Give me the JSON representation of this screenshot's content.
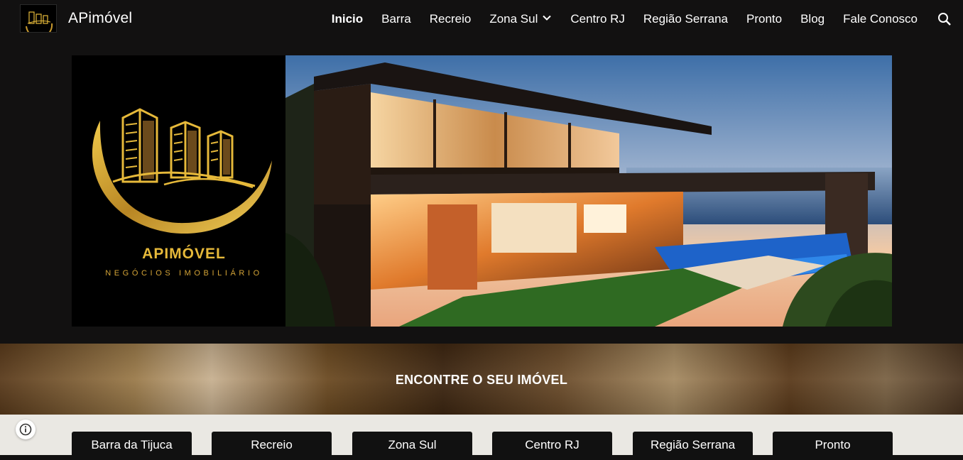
{
  "header": {
    "site_title": "APimóvel",
    "nav": [
      {
        "label": "Inicio",
        "active": true
      },
      {
        "label": "Barra"
      },
      {
        "label": "Recreio"
      },
      {
        "label": "Zona Sul",
        "has_dropdown": true
      },
      {
        "label": "Centro RJ"
      },
      {
        "label": "Região Serrana"
      },
      {
        "label": "Pronto"
      },
      {
        "label": "Blog"
      },
      {
        "label": "Fale Conosco"
      }
    ],
    "search_icon": "search-icon"
  },
  "hero": {
    "brand_name": "APIMÓVEL",
    "brand_tagline": "NEGÓCIOS IMOBILIÁRIO"
  },
  "search_band": {
    "title": "ENCONTRE O SEU IMÓVEL"
  },
  "categories": [
    "Barra da Tijuca",
    "Recreio",
    "Zona Sul",
    "Centro RJ",
    "Região Serrana",
    "Pronto"
  ],
  "colors": {
    "background": "#121111",
    "brand_gold": "#e6b93a",
    "button_bg": "#111111",
    "band_light": "#eae8e3"
  }
}
